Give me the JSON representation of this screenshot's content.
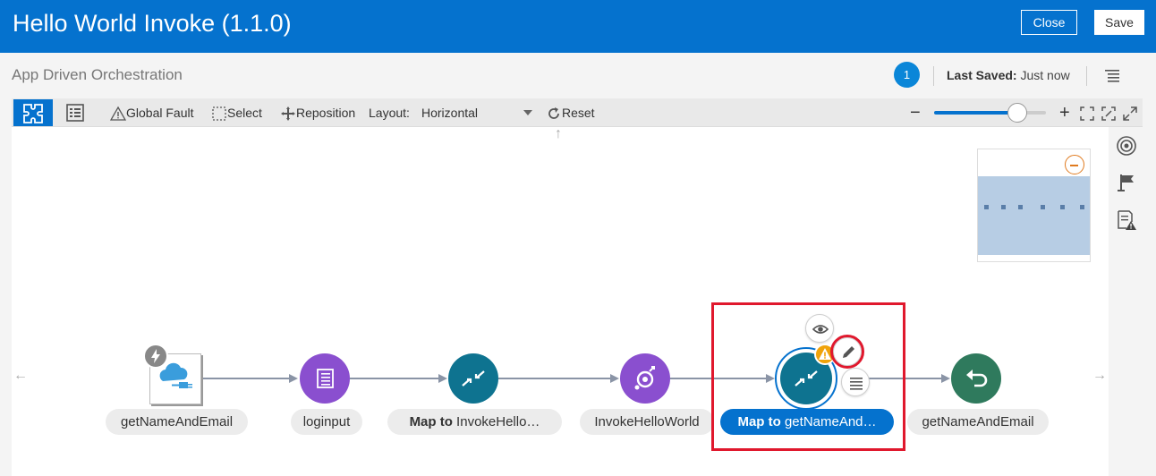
{
  "header": {
    "title": "Hello World Invoke (1.1.0)",
    "close_label": "Close",
    "save_label": "Save"
  },
  "subheader": {
    "title": "App Driven Orchestration",
    "badge_count": "1",
    "last_saved_label": "Last Saved:",
    "last_saved_value": "Just now"
  },
  "toolbar": {
    "global_fault": "Global Fault",
    "select": "Select",
    "reposition": "Reposition",
    "layout_label": "Layout:",
    "layout_value": "Horizontal",
    "reset": "Reset",
    "zoom_minus": "−",
    "zoom_plus": "+"
  },
  "nodes": [
    {
      "id": "trigger",
      "label": "getNameAndEmail",
      "icon": "cloud-plug-icon"
    },
    {
      "id": "log",
      "label": "loginput",
      "icon": "log-icon"
    },
    {
      "id": "map1",
      "label_bold": "Map to",
      "label": " InvokeHello…",
      "icon": "map-icon"
    },
    {
      "id": "invoke",
      "label": "InvokeHelloWorld",
      "icon": "invoke-icon"
    },
    {
      "id": "map2",
      "label_bold": "Map to",
      "label": " getNameAnd…",
      "icon": "map-icon",
      "selected": true
    },
    {
      "id": "return",
      "label": "getNameAndEmail",
      "icon": "return-icon"
    }
  ],
  "colors": {
    "brand_blue": "#0572ce",
    "purple": "#8a4fcf",
    "teal": "#0e7390",
    "green": "#2f7a5d",
    "highlight_red": "#e0182d",
    "warning": "#f0a30a"
  }
}
